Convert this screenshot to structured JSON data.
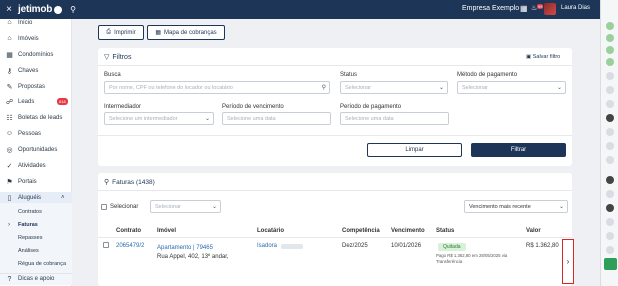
{
  "topbar": {
    "close_icon": "×",
    "logo": "jetimob",
    "company": "Empresa Exemplo",
    "notif_count": "99",
    "user_name": "Laura Dias"
  },
  "sidebar": {
    "items": [
      {
        "label": "Início",
        "icon": "⌂"
      },
      {
        "label": "Imóveis",
        "icon": "⌂"
      },
      {
        "label": "Condomínios",
        "icon": "▦"
      },
      {
        "label": "Chaves",
        "icon": "⚷"
      },
      {
        "label": "Propostas",
        "icon": "✎"
      },
      {
        "label": "Leads",
        "icon": "☍",
        "badge": "818"
      },
      {
        "label": "Boletas de leads",
        "icon": "☷"
      },
      {
        "label": "Pessoas",
        "icon": "☺"
      },
      {
        "label": "Oportunidades",
        "icon": "◎"
      },
      {
        "label": "Atividades",
        "icon": "✓"
      },
      {
        "label": "Portais",
        "icon": "⚑"
      },
      {
        "label": "Aluguéis",
        "icon": "▯"
      }
    ],
    "submenu": [
      {
        "label": "Contratos"
      },
      {
        "label": "Faturas"
      },
      {
        "label": "Repasses"
      },
      {
        "label": "Análises"
      },
      {
        "label": "Régua de cobrança"
      }
    ],
    "help": {
      "label": "Dicas e apoio",
      "icon": "?"
    }
  },
  "toolbar": {
    "print_label": "Imprimir",
    "map_label": "Mapa de cobranças"
  },
  "filters": {
    "title": "Filtros",
    "save_label": "Salvar filtro",
    "busca_label": "Busca",
    "busca_placeholder": "Por nome, CPF ou telefone do locador ou locatário",
    "status_label": "Status",
    "status_value": "Selecionar",
    "metodo_label": "Método de pagamento",
    "metodo_value": "Selecionar",
    "intermediador_label": "Intermediador",
    "intermediador_value": "Selecione um intermediador",
    "vencimento_label": "Período de vencimento",
    "vencimento_placeholder": "Selecione uma data",
    "pagamento_label": "Período de pagamento",
    "pagamento_placeholder": "Selecione uma data",
    "clear_label": "Limpar",
    "filter_label": "Filtrar"
  },
  "invoices": {
    "title": "Faturas (1438)",
    "select_label": "Selecionar",
    "select_value": "Selecionar",
    "sort_value": "Vencimento mais recente",
    "columns": [
      "Contrato",
      "Imóvel",
      "Locatário",
      "Competência",
      "Vencimento",
      "Status",
      "Valor"
    ],
    "rows": [
      {
        "contrato": "2065479/2",
        "imovel_title": "Apartamento | 79465",
        "imovel_address": "Rua Appel, 402, 13º andar,",
        "locatario": "Isadora",
        "competencia": "Dez/2025",
        "vencimento": "10/01/2026",
        "status": "Quitada",
        "status_note": "Pago R$ 1.362,80 em 28/05/2025 via Transferência",
        "valor": "R$ 1.362,80"
      }
    ]
  }
}
